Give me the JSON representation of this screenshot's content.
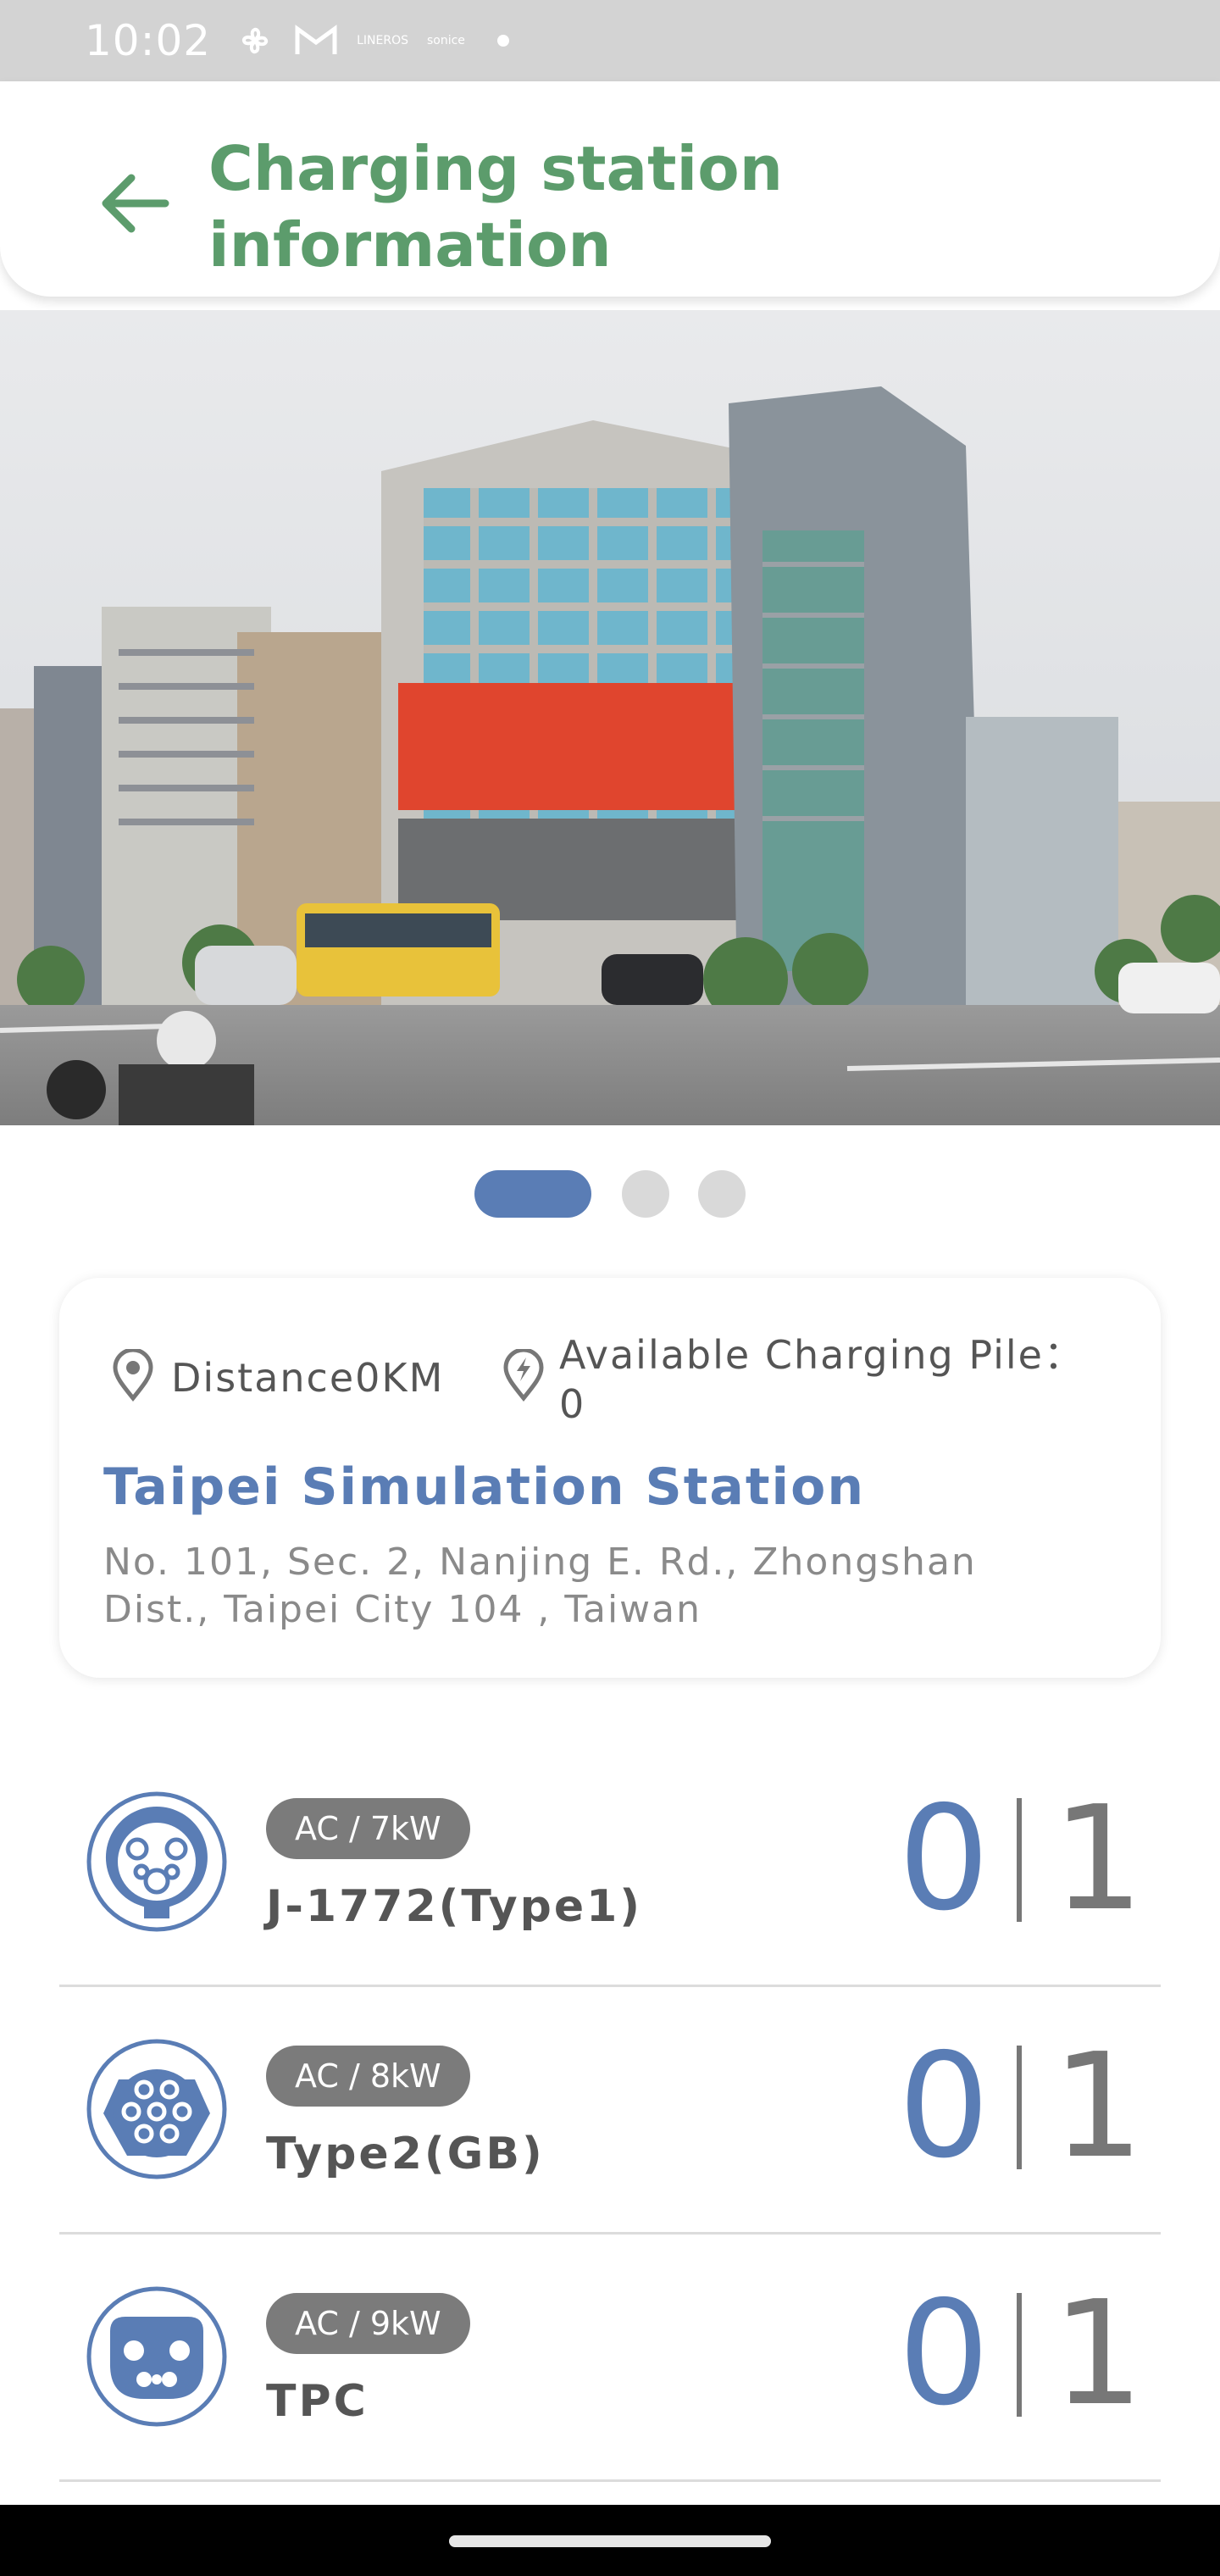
{
  "status_bar": {
    "time": "10:02",
    "icons": [
      "fan-icon",
      "gmail-icon",
      "app-icon",
      "app-icon",
      "dot-icon"
    ],
    "tiny_labels": [
      "LINEROS",
      "sonice"
    ]
  },
  "header": {
    "title_line1": "Charging station",
    "title_line2": "information",
    "back_icon": "arrow-left-icon",
    "accent_color": "#5c9c6c"
  },
  "carousel": {
    "total_pages": 3,
    "active_index": 0,
    "image_description": "street-building-photo"
  },
  "station": {
    "distance_label": "Distance0KM",
    "available_label_line1": "Available Charging Pile：",
    "available_label_line2": "0",
    "name": "Taipei Simulation Station",
    "address_line1": "No. 101, Sec. 2, Nanjing E. Rd., Zhongshan",
    "address_line2": "Dist., Taipei City 104 , Taiwan",
    "brand_color": "#5a7db5"
  },
  "connectors": [
    {
      "badge": "AC / 7kW",
      "name": "J-1772(Type1)",
      "available": "0",
      "total": "1",
      "icon": "j1772-plug-icon"
    },
    {
      "badge": "AC / 8kW",
      "name": "Type2(GB)",
      "available": "0",
      "total": "1",
      "icon": "type2-plug-icon"
    },
    {
      "badge": "AC / 9kW",
      "name": "TPC",
      "available": "0",
      "total": "1",
      "icon": "tpc-plug-icon"
    }
  ]
}
